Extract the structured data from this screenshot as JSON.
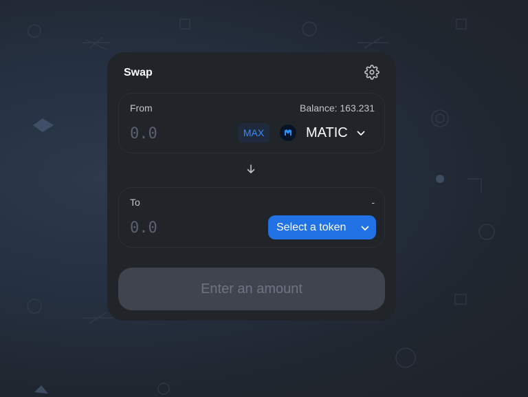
{
  "swap": {
    "title": "Swap",
    "settings_icon": "gear-icon",
    "from": {
      "label": "From",
      "balance": "Balance: 163.231",
      "amount_placeholder": "0.0",
      "max_label": "MAX",
      "token_symbol": "MATIC",
      "token_icon": "matic-logo-icon"
    },
    "switch_icon": "arrow-down-icon",
    "to": {
      "label": "To",
      "balance": "-",
      "amount_placeholder": "0.0",
      "select_label": "Select a token"
    },
    "action_label": "Enter an amount"
  },
  "colors": {
    "card": "#212429",
    "accent": "#2172e5",
    "max_bg": "#1f2a3d",
    "max_text": "#3c8cf6",
    "disabled_button": "#40444f",
    "disabled_text": "#6f7482",
    "matic": "#2891f9"
  }
}
